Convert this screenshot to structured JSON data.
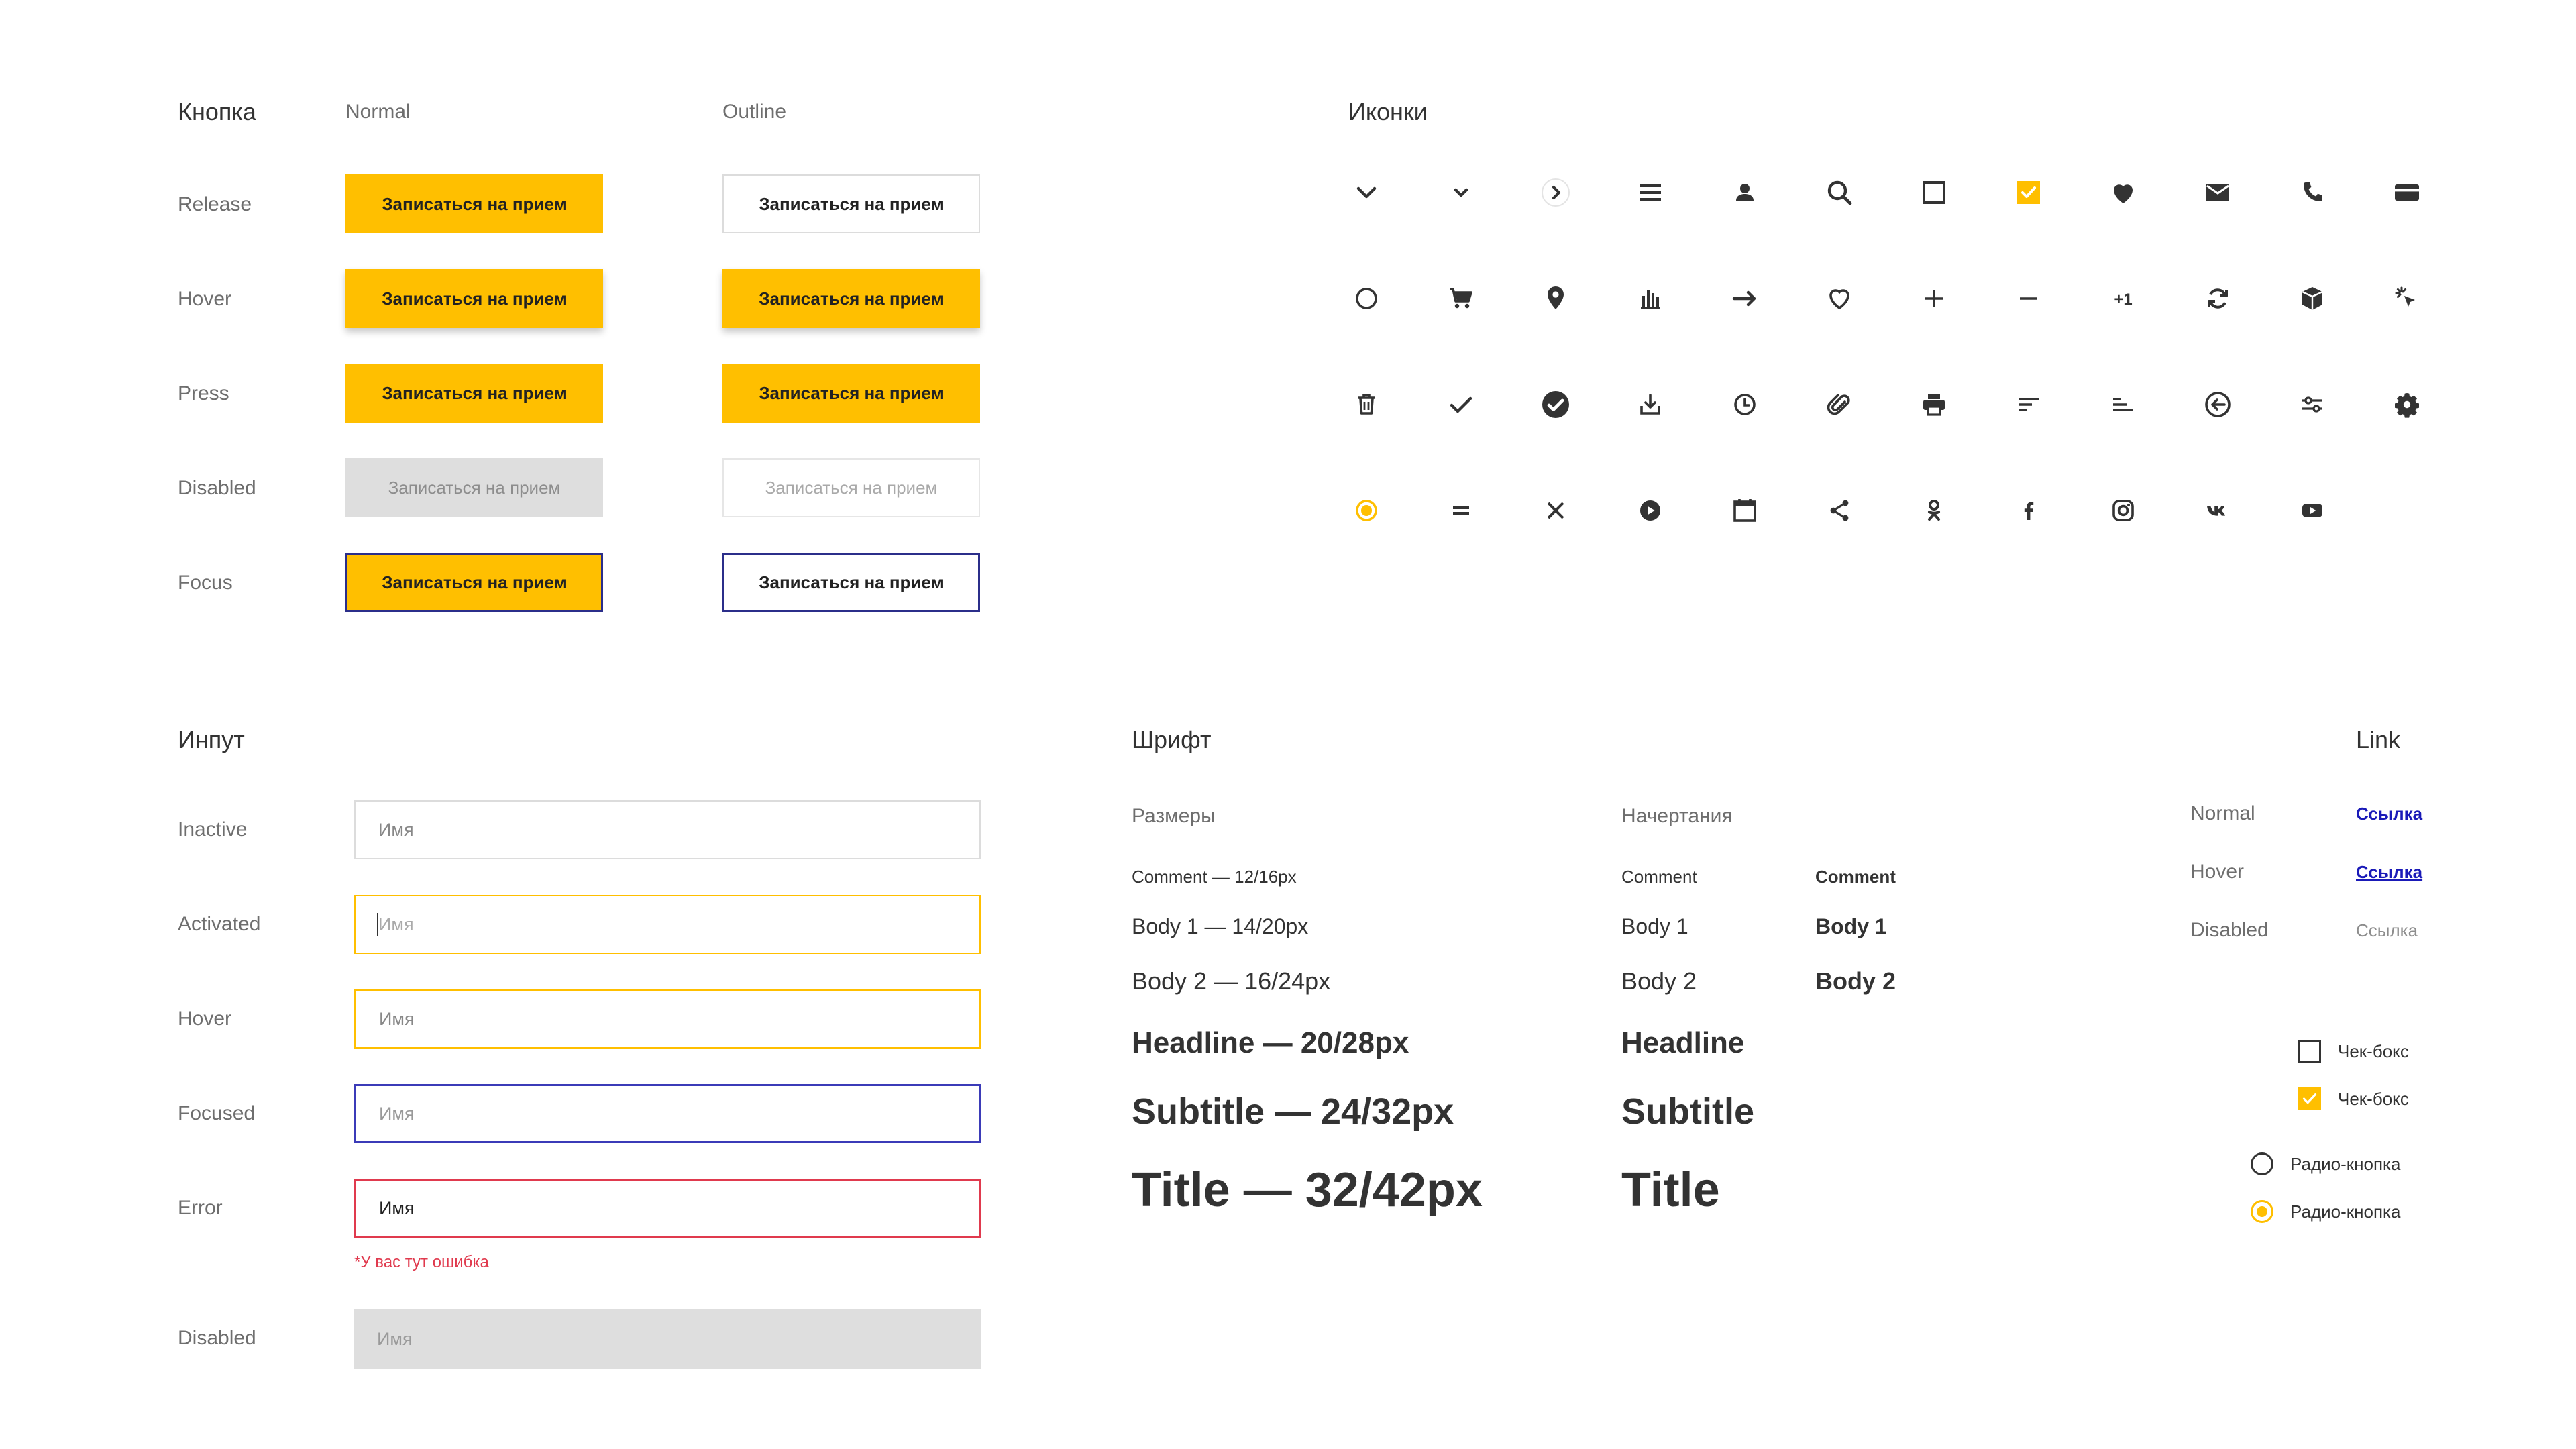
{
  "colors": {
    "accent": "#ffbf00",
    "focus": "#2b2e8a",
    "error": "#e03a4e",
    "link": "#1a1ab8",
    "disabled_bg": "#dedede"
  },
  "buttons": {
    "title": "Кнопка",
    "col_normal": "Normal",
    "col_outline": "Outline",
    "rows": {
      "release": "Release",
      "hover": "Hover",
      "press": "Press",
      "disabled": "Disabled",
      "focus": "Focus"
    },
    "label": "Записаться на прием"
  },
  "icons": {
    "title": "Иконки",
    "row1": [
      "chevron-down-icon",
      "chevron-down-small-icon",
      "chevron-right-circle-icon",
      "menu-icon",
      "user-icon",
      "search-icon",
      "checkbox-empty-icon",
      "checkbox-checked-icon",
      "heart-filled-icon",
      "mail-icon",
      "phone-icon",
      "credit-card-icon"
    ],
    "row2": [
      "circle-icon",
      "cart-icon",
      "location-pin-icon",
      "bar-chart-icon",
      "arrow-right-icon",
      "heart-outline-icon",
      "plus-icon",
      "minus-icon",
      "plus-one-icon",
      "refresh-icon",
      "box-icon",
      "click-icon"
    ],
    "row3": [
      "trash-icon",
      "check-icon",
      "check-circle-icon",
      "download-icon",
      "clock-icon",
      "paperclip-icon",
      "printer-icon",
      "sort-icon",
      "align-bottom-icon",
      "back-circle-icon",
      "sliders-icon",
      "gear-icon"
    ],
    "row4": [
      "radio-on-icon",
      "equals-icon",
      "close-icon",
      "play-circle-icon",
      "calendar-icon",
      "share-icon",
      "odnoklassniki-icon",
      "facebook-icon",
      "instagram-icon",
      "vk-icon",
      "youtube-icon"
    ],
    "plus_one_text": "+1"
  },
  "input": {
    "title": "Инпут",
    "rows": {
      "inactive": "Inactive",
      "activated": "Activated",
      "hover": "Hover",
      "focused": "Focused",
      "error": "Error",
      "disabled": "Disabled"
    },
    "placeholder": "Имя",
    "error_message": "*У вас тут ошибка"
  },
  "fonts": {
    "title": "Шрифт",
    "sizes_head": "Размеры",
    "styles_head": "Начертания",
    "sizes": {
      "comment": "Comment — 12/16px",
      "body1": "Body 1 — 14/20px",
      "body2": "Body 2 — 16/24px",
      "headline": "Headline — 20/28px",
      "subtitle": "Subtitle — 24/32px",
      "title": "Title — 32/42px"
    },
    "styles": {
      "comment": "Comment",
      "body1": "Body 1",
      "body2": "Body 2",
      "headline": "Headline",
      "subtitle": "Subtitle",
      "title": "Title"
    }
  },
  "link": {
    "title": "Link",
    "rows": {
      "normal": "Normal",
      "hover": "Hover",
      "disabled": "Disabled"
    },
    "label": "Ссылка"
  },
  "controls": {
    "checkbox_label": "Чек-бокс",
    "radio_label": "Радио-кнопка"
  }
}
